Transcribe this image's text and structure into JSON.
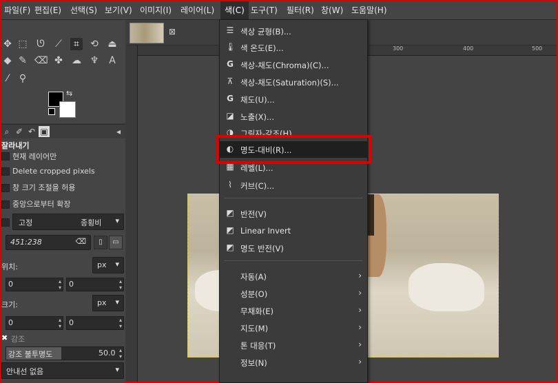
{
  "menubar": {
    "items": [
      "파일(F)",
      "편집(E)",
      "선택(S)",
      "보기(V)",
      "이미지(I)",
      "레이어(L)",
      "색(C)",
      "도구(T)",
      "필터(R)",
      "창(W)",
      "도움말(H)"
    ],
    "active_index": 6
  },
  "image_tab": {
    "close": "⊠"
  },
  "ruler": {
    "ticks": [
      "300",
      "400",
      "500"
    ]
  },
  "tool_options": {
    "title": "잘라내기",
    "current_layer_only": "현재 레이어만",
    "delete_cropped": "Delete cropped pixels",
    "allow_growing": "창 크기 조절을 허용",
    "expand_center": "중앙으로부터 확장",
    "fixed_label": "고정",
    "fixed_value": "종횡비",
    "ratio_value": "451:238",
    "position_label": "위치:",
    "position_unit": "px",
    "position_x": "0",
    "position_y": "0",
    "size_label": "크기:",
    "size_unit": "px",
    "size_w": "0",
    "size_h": "0",
    "highlight_label": "강조",
    "highlight_opacity_label": "강조 불투명도",
    "highlight_opacity_value": "50.0",
    "guides_value": "안내선 없음"
  },
  "color_menu": {
    "items": [
      {
        "icon": "color-balance-icon",
        "label": "색상 균형(B)..."
      },
      {
        "icon": "thermometer-icon",
        "label": "색 온도(E)..."
      },
      {
        "icon": "g-icon",
        "label": "색상-채도(Chroma)(C)..."
      },
      {
        "icon": "hue-saturation-icon",
        "label": "색상-채도(Saturation)(S)..."
      },
      {
        "icon": "g-icon",
        "label": "채도(U)..."
      },
      {
        "icon": "exposure-icon",
        "label": "노출(X)..."
      },
      {
        "icon": "shadows-highlights-icon",
        "label": "그림자-강조(H)..."
      },
      {
        "icon": "brightness-contrast-icon",
        "label": "명도-대비(R)..."
      },
      {
        "icon": "levels-icon",
        "label": "레벨(L)..."
      },
      {
        "icon": "curves-icon",
        "label": "커브(C)..."
      }
    ],
    "invert_items": [
      {
        "icon": "invert-icon",
        "label": "반전(V)"
      },
      {
        "icon": "invert-icon",
        "label": "Linear Invert"
      },
      {
        "icon": "invert-icon",
        "label": "명도 반전(V)"
      }
    ],
    "submenus": [
      "자동(A)",
      "성분(O)",
      "무채화(E)",
      "지도(M)",
      "톤 대응(T)",
      "정보(N)"
    ]
  },
  "colors": {
    "highlight_box": "#e00000",
    "selection": "#d9d23a"
  }
}
